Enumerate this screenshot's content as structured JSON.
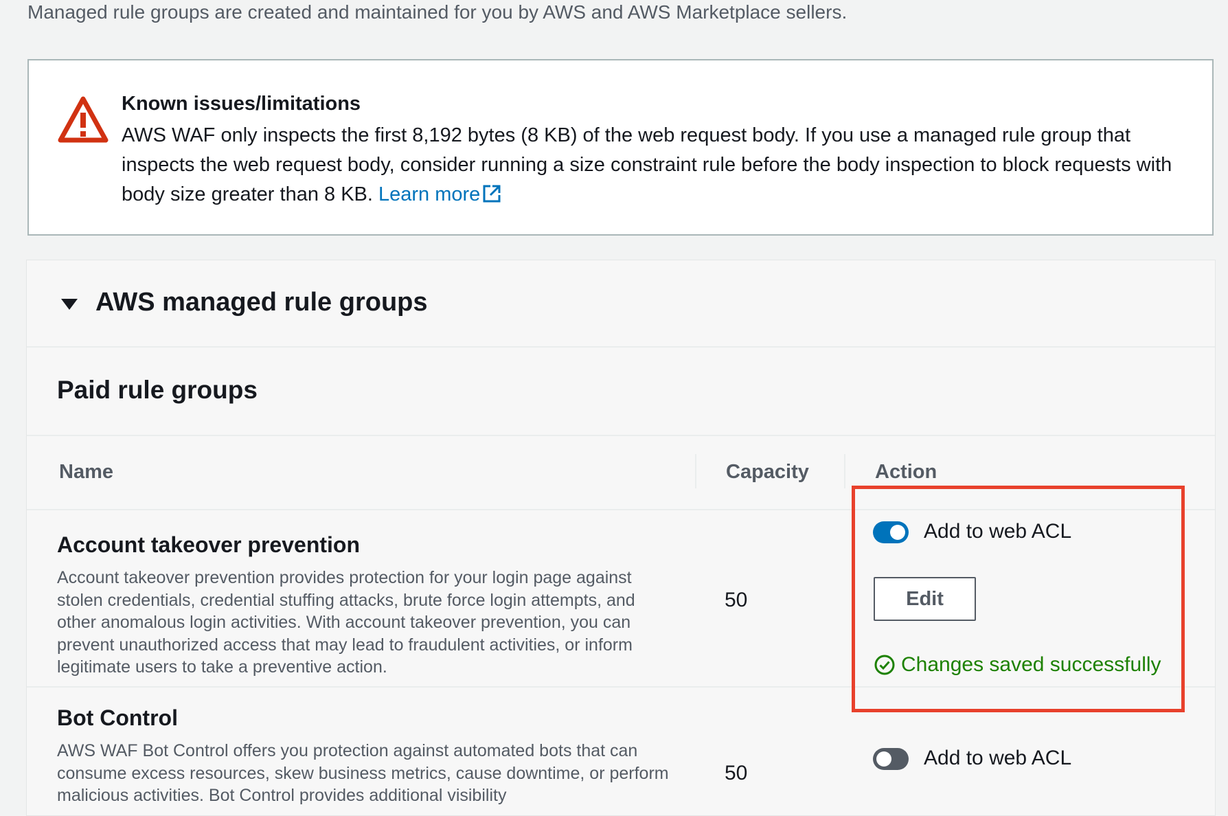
{
  "intro_text": "Managed rule groups are created and maintained for you by AWS and AWS Marketplace sellers.",
  "alert": {
    "title": "Known issues/limitations",
    "body": "AWS WAF only inspects the first 8,192 bytes (8 KB) of the web request body. If you use a managed rule group that inspects the web request body, consider running a size constraint rule before the body inspection to block requests with body size greater than 8 KB.",
    "link_text": "Learn more",
    "icon": "warning-triangle-icon",
    "icon_color": "#d13212"
  },
  "section": {
    "title": "AWS managed rule groups",
    "expanded": true
  },
  "subsection": {
    "title": "Paid rule groups"
  },
  "table": {
    "columns": [
      "Name",
      "Capacity",
      "Action"
    ],
    "rows": [
      {
        "name": "Account takeover prevention",
        "description": "Account takeover prevention provides protection for your login page against stolen credentials, credential stuffing attacks, brute force login attempts, and other anomalous login activities. With account takeover prevention, you can prevent unauthorized access that may lead to fraudulent activities, or inform legitimate users to take a preventive action.",
        "capacity": "50",
        "toggle_label": "Add to web ACL",
        "toggle_on": true,
        "edit_label": "Edit",
        "status": "Changes saved successfully"
      },
      {
        "name": "Bot Control",
        "description": "AWS WAF Bot Control offers you protection against automated bots that can consume excess resources, skew business metrics, cause downtime, or perform malicious activities. Bot Control provides additional visibility",
        "capacity": "50",
        "toggle_label": "Add to web ACL",
        "toggle_on": false
      }
    ]
  },
  "colors": {
    "accent": "#0073bb",
    "success": "#1d8102",
    "highlight": "#e8412c"
  }
}
